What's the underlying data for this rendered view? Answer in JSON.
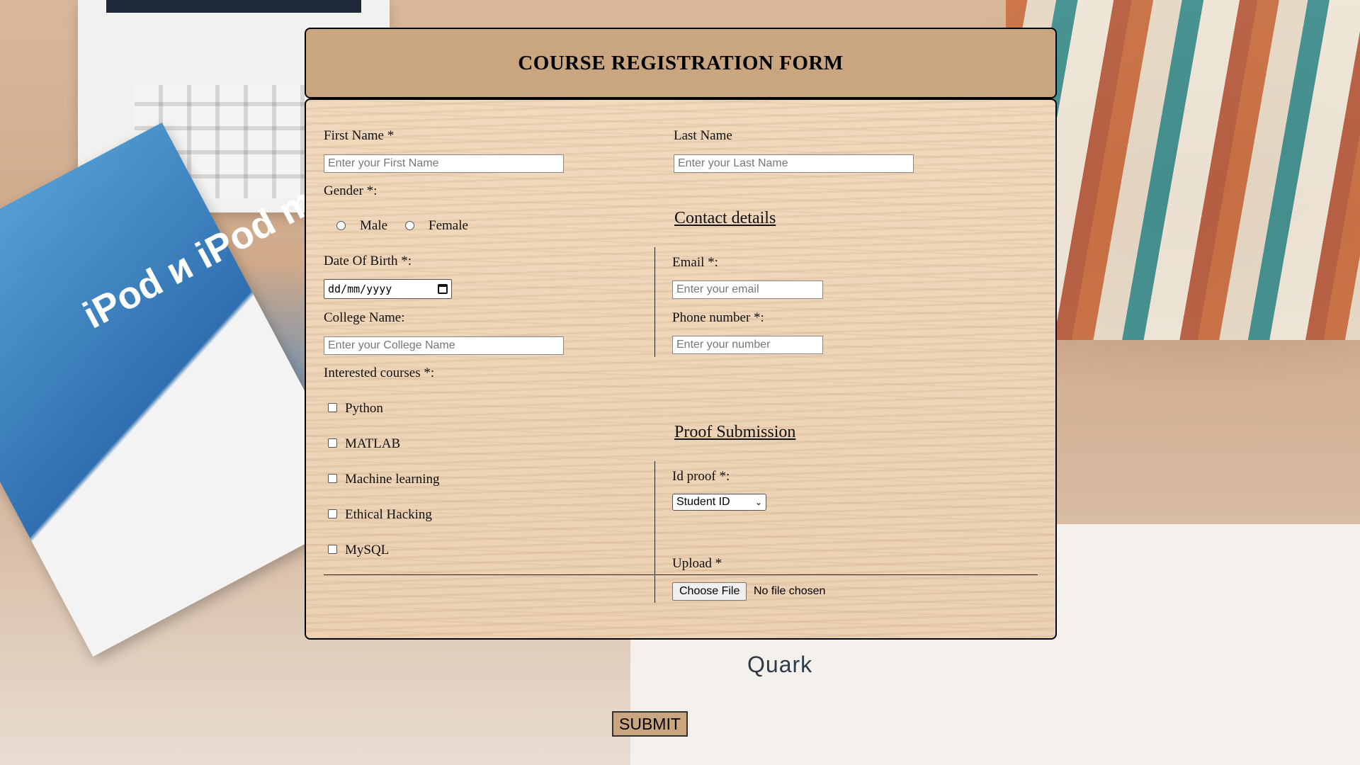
{
  "header": {
    "title": "COURSE REGISTRATION FORM"
  },
  "form": {
    "first_name": {
      "label": "First Name *",
      "placeholder": "Enter your First Name"
    },
    "last_name": {
      "label": "Last Name",
      "placeholder": "Enter your Last Name"
    },
    "gender": {
      "label": "Gender *:",
      "options": [
        "Male",
        "Female"
      ]
    },
    "contact_section": "Contact details",
    "dob": {
      "label": "Date Of Birth *:",
      "placeholder": "dd/mm/yyyy"
    },
    "email": {
      "label": "Email *:",
      "placeholder": "Enter your email"
    },
    "college": {
      "label": "College Name:",
      "placeholder": "Enter your College Name"
    },
    "phone": {
      "label": "Phone number *:",
      "placeholder": "Enter your number"
    },
    "courses": {
      "label": "Interested courses *:",
      "options": [
        "Python",
        "MATLAB",
        "Machine learning",
        "Ethical Hacking",
        "MySQL"
      ]
    },
    "proof_section": "Proof Submission",
    "id_proof": {
      "label": "Id proof *:",
      "selected": "Student ID"
    },
    "upload": {
      "label": "Upload *",
      "button": "Choose File",
      "status": "No file chosen"
    },
    "submit_label": "SUBMIT"
  },
  "background": {
    "brand_text": "Quark",
    "book_text": "iPod и iPod mi"
  }
}
